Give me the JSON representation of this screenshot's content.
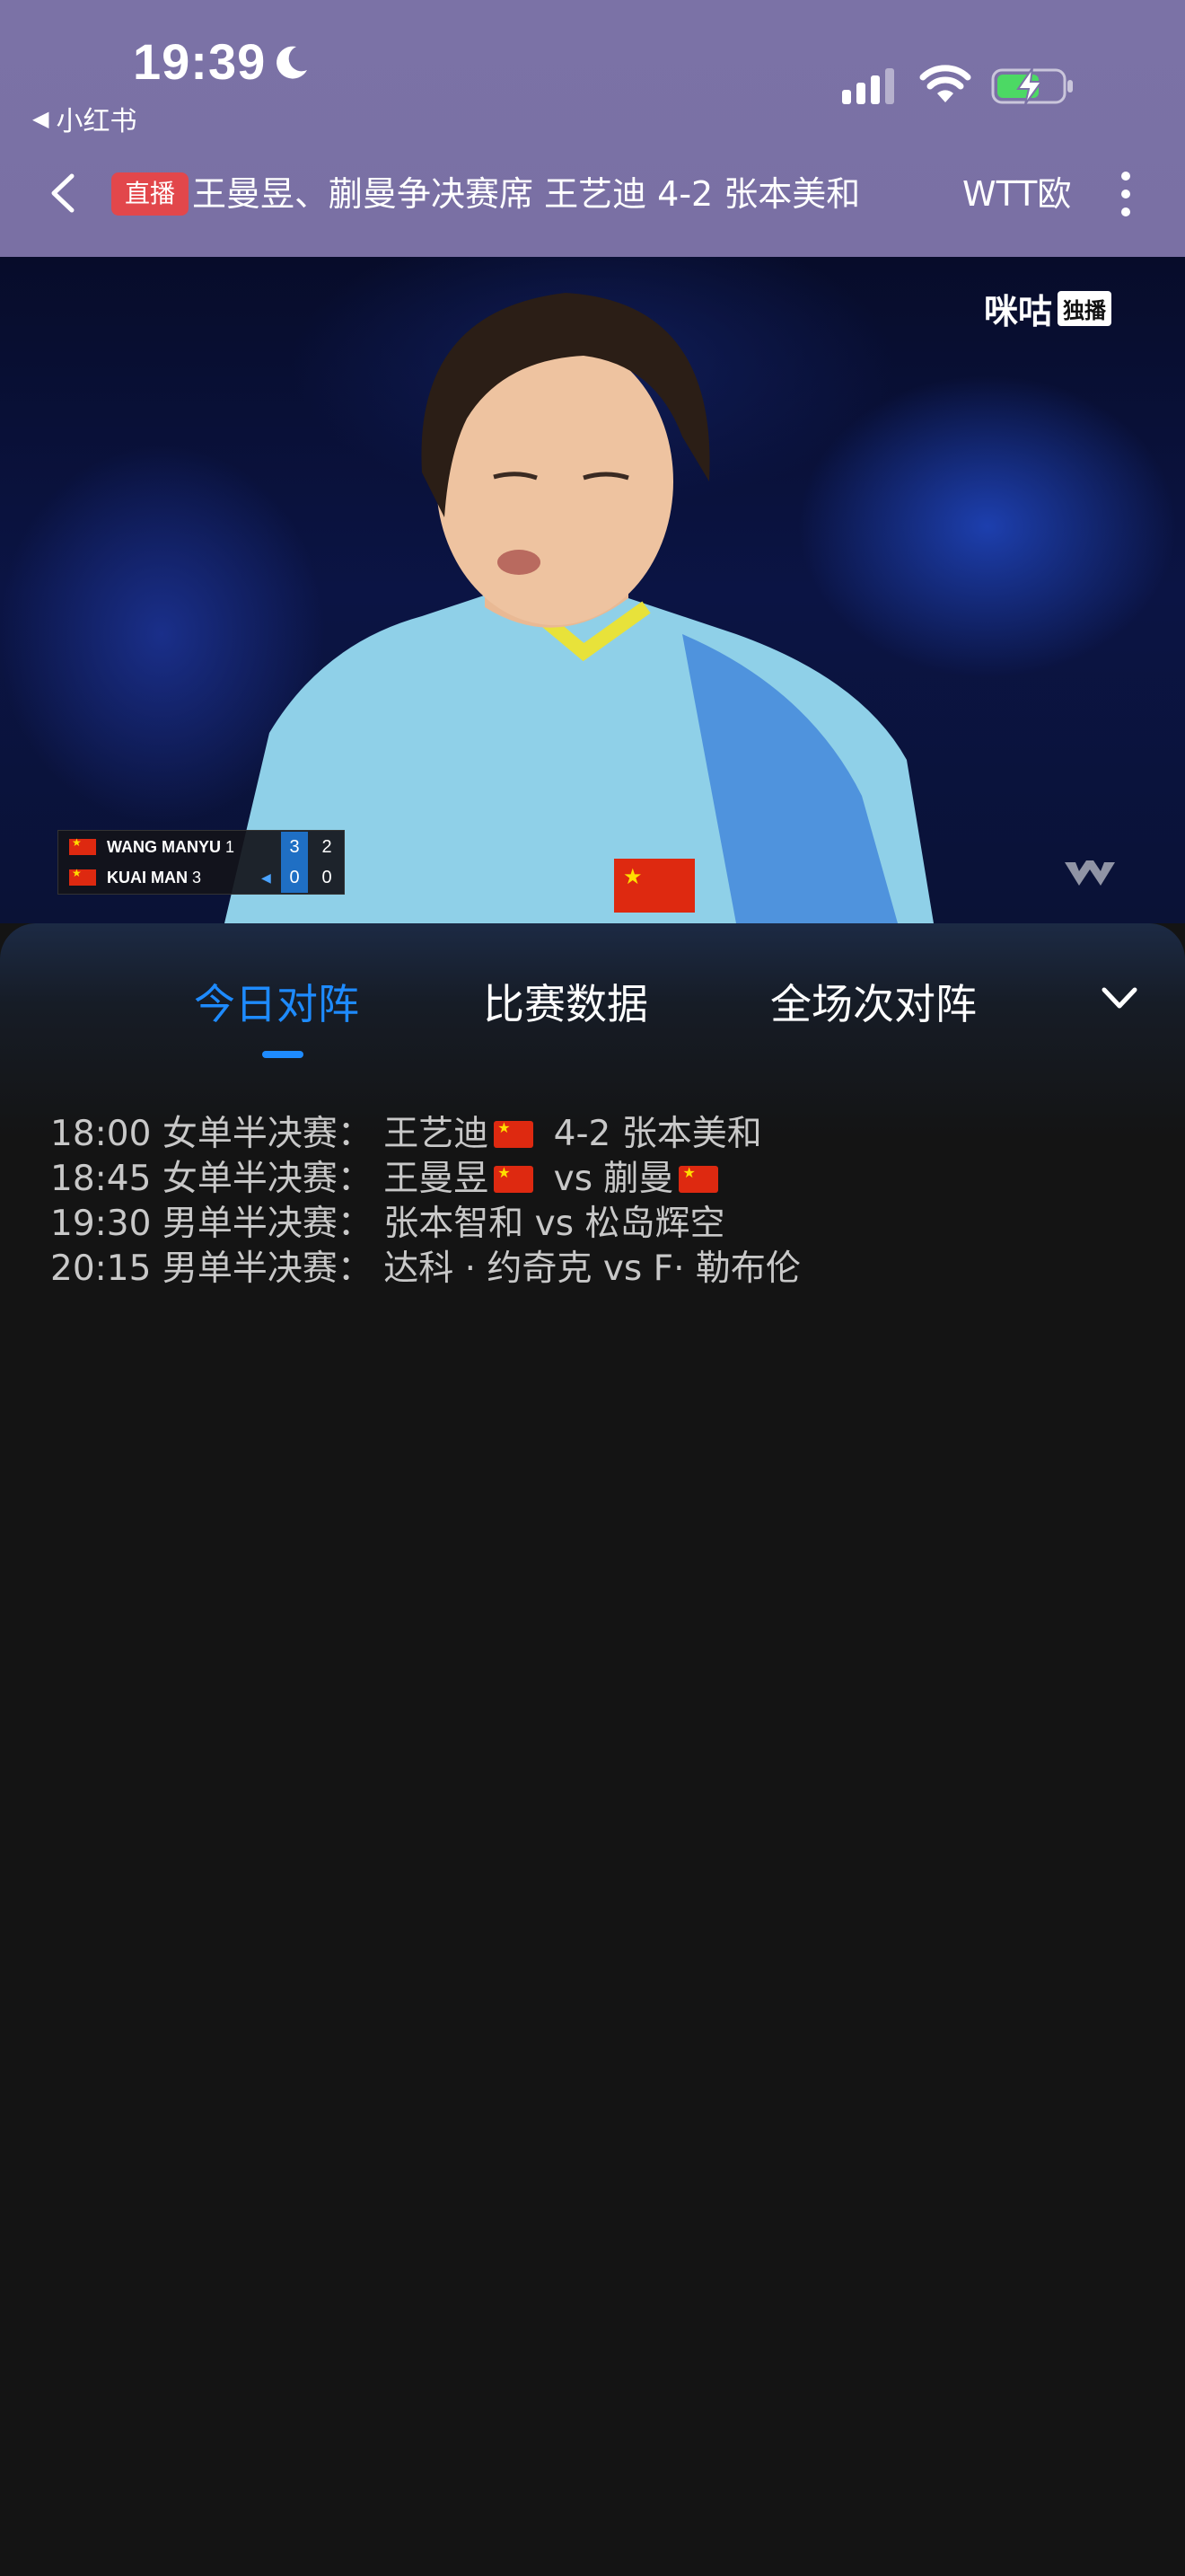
{
  "status_bar": {
    "time": "19:39",
    "back_app_label": "小红书"
  },
  "header": {
    "live_badge": "直播",
    "title": "王曼昱、蒯曼争决赛席 王艺迪 4-2 张本美和",
    "next_title": "WTT欧"
  },
  "video": {
    "watermark": "咪咕",
    "watermark_badge": "独播",
    "scoreboard": [
      {
        "name": "WANG MANYU",
        "seed": "1",
        "games": "3",
        "points": "2"
      },
      {
        "name": "KUAI MAN",
        "seed": "3",
        "games": "0",
        "points": "0"
      }
    ]
  },
  "tabs": [
    {
      "label": "今日对阵",
      "active": true
    },
    {
      "label": "比赛数据",
      "active": false
    },
    {
      "label": "全场次对阵",
      "active": false
    }
  ],
  "schedule": [
    {
      "time": "18:00",
      "event": "女单半决赛：",
      "player1": "王艺迪",
      "p1_flag": true,
      "vs": "4-2",
      "player2": "张本美和",
      "p2_flag": false
    },
    {
      "time": "18:45",
      "event": "女单半决赛：",
      "player1": "王曼昱",
      "p1_flag": true,
      "vs": "vs",
      "player2": "蒯曼",
      "p2_flag": true
    },
    {
      "time": "19:30",
      "event": "男单半决赛：",
      "player1": "张本智和",
      "p1_flag": false,
      "vs": "vs",
      "player2": "松岛辉空",
      "p2_flag": false
    },
    {
      "time": "20:15",
      "event": "男单半决赛：",
      "player1": "达科 · 约奇克",
      "p1_flag": false,
      "vs": "vs",
      "player2": "F· 勒布伦",
      "p2_flag": false
    }
  ],
  "colors": {
    "header_bg": "#7b72a6",
    "accent": "#1e8bff",
    "live_red": "#e2474b",
    "panel_bg": "#141414"
  }
}
